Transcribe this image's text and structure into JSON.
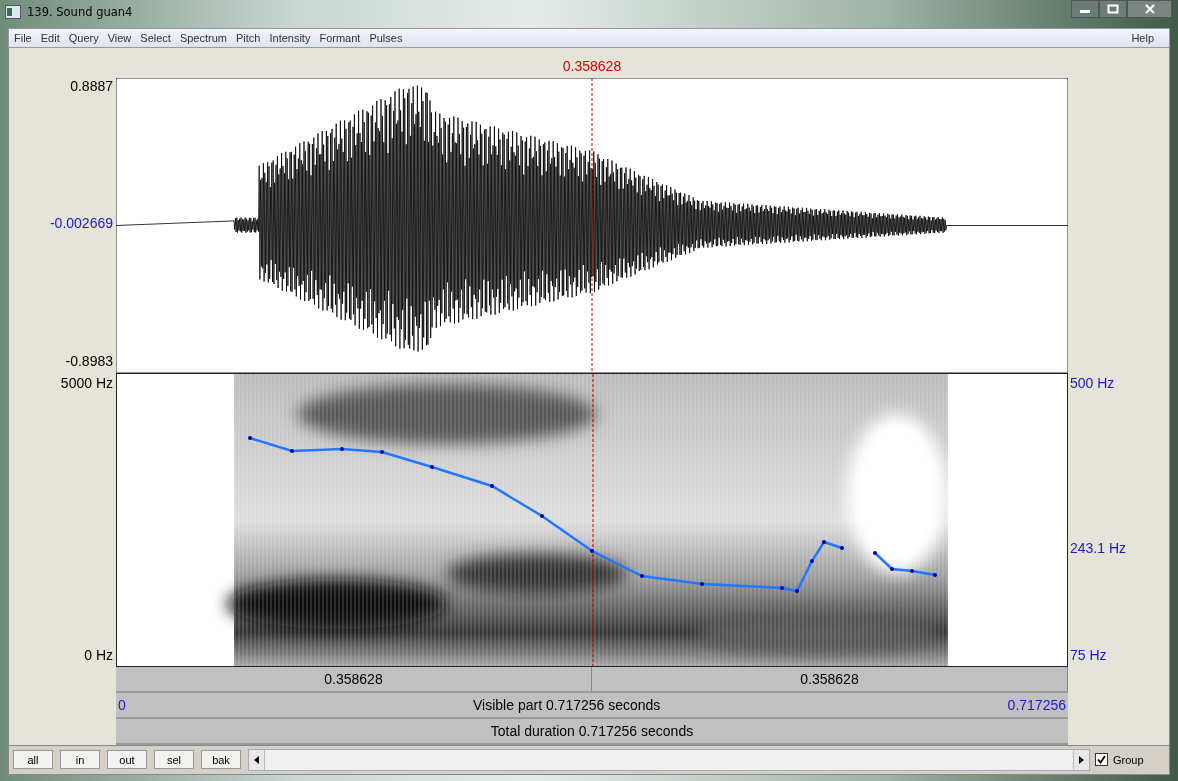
{
  "window": {
    "title": "139. Sound guan4"
  },
  "menu": {
    "items": [
      "File",
      "Edit",
      "Query",
      "View",
      "Select",
      "Spectrum",
      "Pitch",
      "Intensity",
      "Formant",
      "Pulses"
    ],
    "help": "Help"
  },
  "cursor_time": "0.358628",
  "waveform": {
    "y_max": "0.8887",
    "y_mid": "-0.002669",
    "y_min": "-0.8983"
  },
  "spectrogram": {
    "freq_max": "5000 Hz",
    "freq_min": "0 Hz"
  },
  "pitch": {
    "max": "500 Hz",
    "current": "243.1 Hz",
    "min": "75 Hz"
  },
  "time_rows": {
    "left_of_cursor": "0.358628",
    "right_of_cursor": "0.358628",
    "visible_start": "0",
    "visible_label": "Visible part 0.717256 seconds",
    "visible_end": "0.717256",
    "total_label": "Total duration 0.717256 seconds"
  },
  "buttons": [
    "all",
    "in",
    "out",
    "sel",
    "bak"
  ],
  "group": {
    "label": "Group",
    "checked": true
  }
}
